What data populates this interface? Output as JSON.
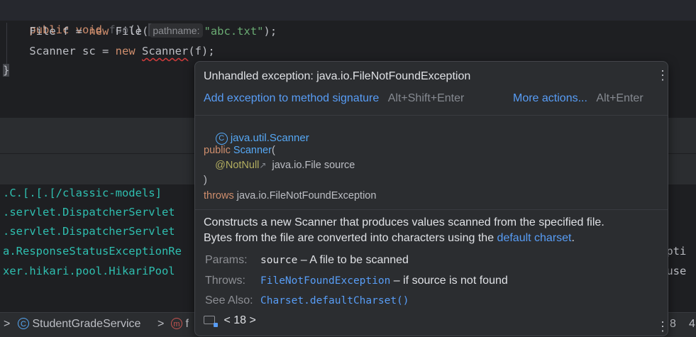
{
  "editor": {
    "line1": {
      "kw1": "public",
      "kw2": "void",
      "name": "foo",
      "rest": "() ",
      "brace": "{"
    },
    "line2": {
      "type": "File",
      "rest1": " f = ",
      "kw": "new",
      "call": " File(",
      "hint": "pathname:",
      "string": "\"abc.txt\"",
      "end": ");"
    },
    "line3": {
      "type": "Scanner",
      "rest1": " sc = ",
      "kw": "new",
      "call": "Scanner",
      "end": "(f);"
    },
    "line4": {
      "brace": "}"
    }
  },
  "console": {
    "lines": [
      ".C.[.[.[/classic-models]",
      ".servlet.DispatcherServlet",
      ".servlet.DispatcherServlet",
      "a.ResponseStatusExceptionRe",
      "xer.hikari.pool.HikariPool"
    ],
    "right_fragments": [
      "epti",
      "ouse"
    ]
  },
  "status": {
    "chevron": ">",
    "class_name": "StudentGradeService",
    "class_icon": "class-icon",
    "sep": ">",
    "method_letter": "f",
    "method_icon": "method-icon",
    "line_col_fragment": "8",
    "right_fragment": "4"
  },
  "popup": {
    "title": "Unhandled exception: java.io.FileNotFoundException",
    "action_primary": "Add exception to method signature",
    "action_primary_shortcut": "Alt+Shift+Enter",
    "action_more": "More actions...",
    "action_more_shortcut": "Alt+Enter",
    "class_fqn": "java.util.Scanner",
    "signature": {
      "modifier": "public",
      "ctor": "Scanner",
      "open": "(",
      "annotation": "@NotNull",
      "param": "java.io.File source",
      "close": ")",
      "throws_kw": "throws",
      "throws_type": "java.io.FileNotFoundException"
    },
    "description": {
      "part1": "Constructs a new ",
      "code1": "Scanner",
      "part2": " that produces values scanned from the specified file.",
      "part3": "Bytes from the file are converted into characters using the ",
      "link": "default charset",
      "part4": "."
    },
    "params": {
      "label": "Params:",
      "name": "source",
      "text": " – A file to be scanned"
    },
    "throws": {
      "label": "Throws:",
      "name": "FileNotFoundException",
      "text": " – if source is not found"
    },
    "see_also": {
      "label": "See Also:",
      "name": "Charset.defaultCharset()"
    },
    "nav": "< 18 >"
  }
}
